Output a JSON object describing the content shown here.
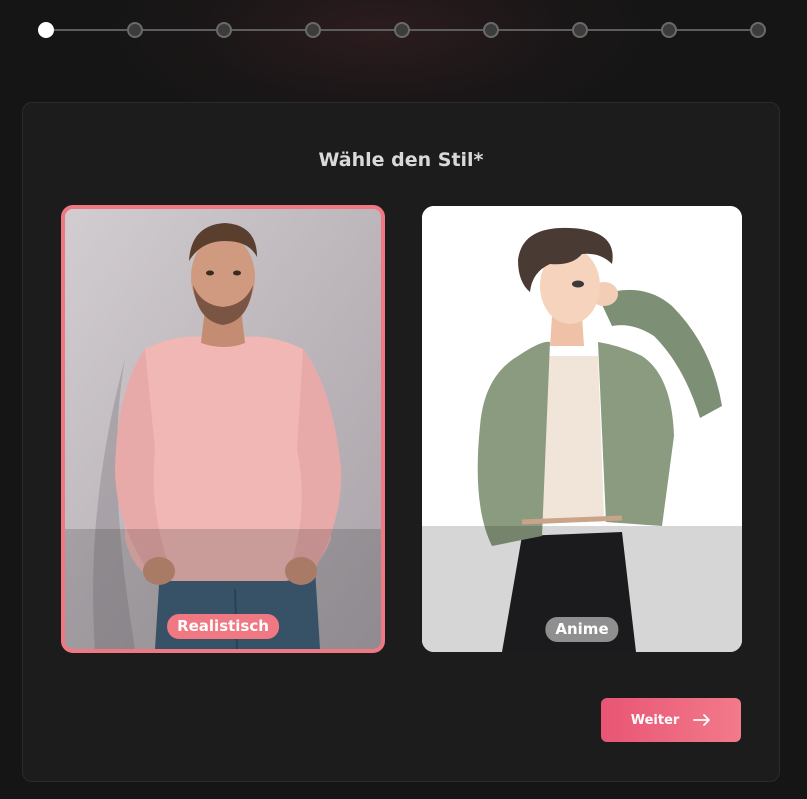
{
  "progress": {
    "total_steps": 9,
    "current_step": 1
  },
  "card": {
    "title": "Wähle den Stil*"
  },
  "options": [
    {
      "id": "realistic",
      "label": "Realistisch",
      "selected": true
    },
    {
      "id": "anime",
      "label": "Anime",
      "selected": false
    }
  ],
  "actions": {
    "next_label": "Weiter"
  },
  "colors": {
    "accent": "#f07882",
    "button_start": "#e85574",
    "button_end": "#f27a8a",
    "card_bg": "#1c1c1c",
    "page_bg": "#151515"
  },
  "icons": {
    "next": "arrow-right-icon"
  }
}
